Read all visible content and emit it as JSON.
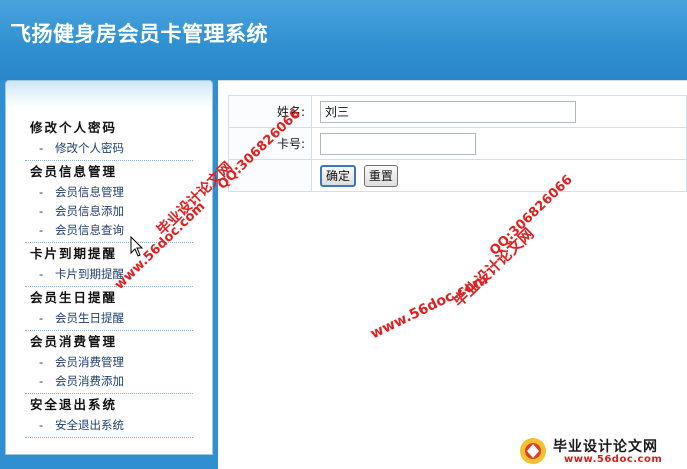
{
  "header": {
    "title": "飞扬健身房会员卡管理系统"
  },
  "sidebar": {
    "groups": [
      {
        "title": "修改个人密码",
        "items": [
          "修改个人密码"
        ]
      },
      {
        "title": "会员信息管理",
        "items": [
          "会员信息管理",
          "会员信息添加",
          "会员信息查询"
        ]
      },
      {
        "title": "卡片到期提醒",
        "items": [
          "卡片到期提醒"
        ]
      },
      {
        "title": "会员生日提醒",
        "items": [
          "会员生日提醒"
        ]
      },
      {
        "title": "会员消费管理",
        "items": [
          "会员消费管理",
          "会员消费添加"
        ]
      },
      {
        "title": "安全退出系统",
        "items": [
          "安全退出系统"
        ]
      }
    ],
    "item_prefix": "-"
  },
  "form": {
    "name_label": "姓名:",
    "name_value": "刘三",
    "card_label": "卡号:",
    "card_value": "",
    "submit_label": "确定",
    "reset_label": "重置"
  },
  "watermarks": {
    "site_url": "www.56doc.com",
    "site_name": "毕业设计论文网",
    "qq": "QQ:306826066"
  },
  "logo": {
    "title": "毕业设计论文网",
    "url": "www.56doc.com"
  },
  "colors": {
    "header_blue": "#2f8fd0",
    "watermark_red": "#e02020"
  }
}
